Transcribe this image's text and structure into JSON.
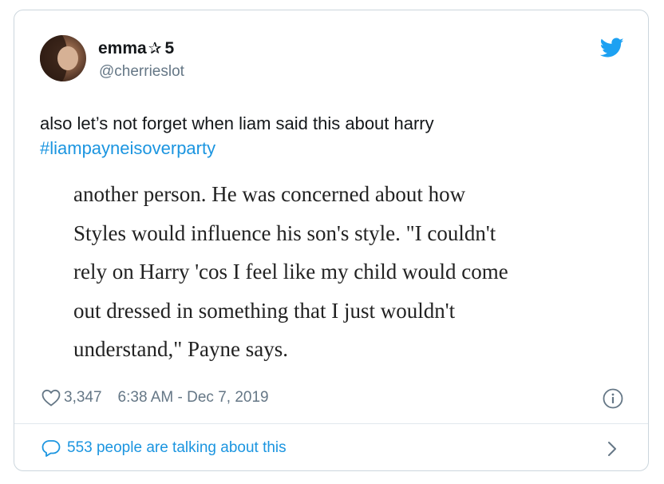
{
  "user": {
    "display_name": "emma",
    "name_star": "✰",
    "name_suffix": "5",
    "handle": "@cherrieslot"
  },
  "tweet": {
    "text": "also let’s not forget when liam said this about harry",
    "hashtag": "#liampayneisoverparty"
  },
  "quoted_image": {
    "lines": [
      "another person. He was concerned about how",
      "Styles would influence his son's style. \"I couldn't",
      "rely on Harry 'cos I feel like my child would come",
      "out dressed in something that I just wouldn't",
      "understand,\" Payne says."
    ]
  },
  "meta": {
    "like_count": "3,347",
    "timestamp": "6:38 AM - Dec 7, 2019"
  },
  "footer": {
    "talking_label": "553 people are talking about this"
  },
  "colors": {
    "accent": "#1b95e0",
    "secondary_text": "#657786",
    "primary_text": "#14171a",
    "border": "#ccd6dd"
  },
  "icons": {
    "brand": "twitter-bird-icon",
    "like": "heart-icon",
    "info": "info-icon",
    "reply": "speech-bubble-icon",
    "chevron": "chevron-right-icon"
  }
}
